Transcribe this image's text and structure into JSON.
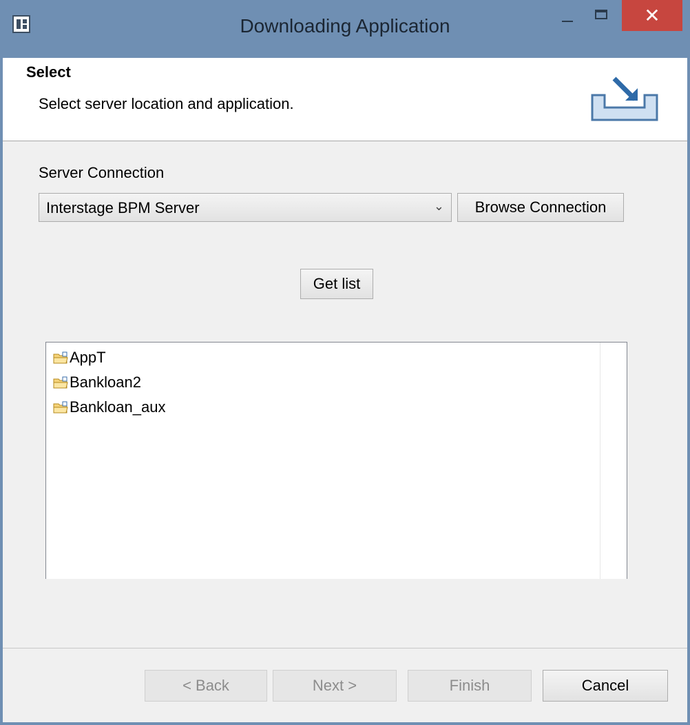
{
  "window": {
    "title": "Downloading Application",
    "close_glyph": "✕"
  },
  "header": {
    "title": "Select",
    "description": "Select server location and application."
  },
  "form": {
    "server_connection_label": "Server Connection",
    "server_connection_value": "Interstage BPM Server",
    "browse_connection_label": "Browse Connection",
    "get_list_label": "Get list"
  },
  "applications": [
    {
      "name": "AppT"
    },
    {
      "name": "Bankloan2"
    },
    {
      "name": "Bankloan_aux"
    }
  ],
  "buttons": {
    "back": "< Back",
    "next": "Next >",
    "finish": "Finish",
    "cancel": "Cancel"
  },
  "colors": {
    "titlebar": "#6f8fb3",
    "close": "#c7463f"
  }
}
